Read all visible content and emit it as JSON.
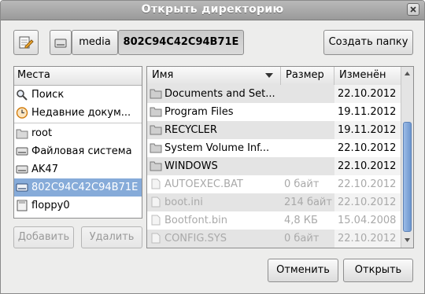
{
  "window": {
    "title": "Открыть директорию"
  },
  "toolbar": {
    "path_segments": [
      {
        "label": "media"
      },
      {
        "label": "802C94C42C94B71E"
      }
    ],
    "create_folder_label": "Создать папку"
  },
  "places": {
    "header": "Места",
    "items": [
      {
        "label": "Поиск",
        "icon": "search-icon"
      },
      {
        "label": "Недавние докум...",
        "icon": "recent-icon"
      },
      {
        "label": "root",
        "icon": "folder-icon"
      },
      {
        "label": "Файловая система",
        "icon": "drive-icon"
      },
      {
        "label": "AK47",
        "icon": "drive-icon"
      },
      {
        "label": "802C94C42C94B71E",
        "icon": "drive-icon"
      },
      {
        "label": "floppy0",
        "icon": "floppy-icon"
      }
    ],
    "add_label": "Добавить",
    "remove_label": "Удалить"
  },
  "files": {
    "columns": {
      "name": "Имя",
      "size": "Размер",
      "modified": "Изменён"
    },
    "rows": [
      {
        "name": "Documents and Set...",
        "size": "",
        "modified": "22.10.2012",
        "type": "folder",
        "enabled": true
      },
      {
        "name": "Program Files",
        "size": "",
        "modified": "19.11.2012",
        "type": "folder",
        "enabled": true
      },
      {
        "name": "RECYCLER",
        "size": "",
        "modified": "19.11.2012",
        "type": "folder",
        "enabled": true
      },
      {
        "name": "System Volume Inf...",
        "size": "",
        "modified": "22.10.2012",
        "type": "folder",
        "enabled": true
      },
      {
        "name": "WINDOWS",
        "size": "",
        "modified": "22.10.2012",
        "type": "folder",
        "enabled": true
      },
      {
        "name": "AUTOEXEC.BAT",
        "size": "0 байт",
        "modified": "22.10.2012",
        "type": "file",
        "enabled": false
      },
      {
        "name": "boot.ini",
        "size": "214 байт",
        "modified": "22.10.2012",
        "type": "file",
        "enabled": false
      },
      {
        "name": "Bootfont.bin",
        "size": "4,8 КБ",
        "modified": "15.04.2008",
        "type": "file",
        "enabled": false
      },
      {
        "name": "CONFIG.SYS",
        "size": "0 байт",
        "modified": "22.10.2012",
        "type": "file",
        "enabled": false
      }
    ]
  },
  "actions": {
    "cancel_label": "Отменить",
    "open_label": "Открыть"
  },
  "colors": {
    "selection": "#86abd9",
    "accent": "#6e97cf"
  }
}
